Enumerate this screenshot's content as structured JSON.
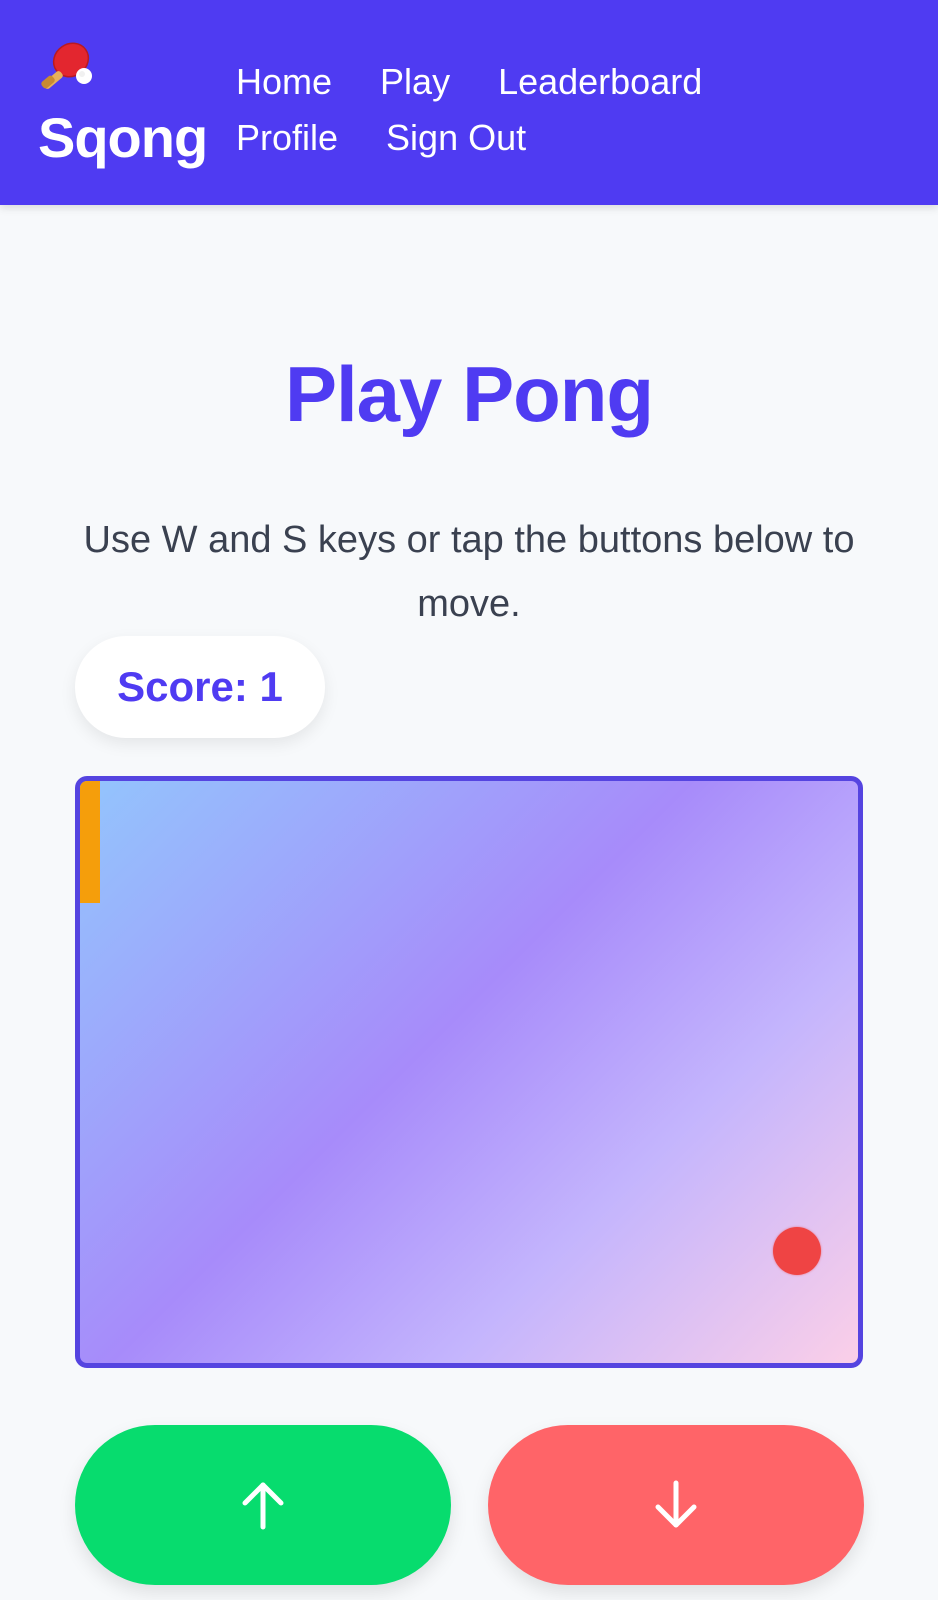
{
  "header": {
    "brand_icon": "ping-pong-paddle-icon",
    "brand_name": "Sqong",
    "nav": {
      "row1": [
        "Home",
        "Play",
        "Leaderboard"
      ],
      "row2": [
        "Profile",
        "Sign Out"
      ]
    }
  },
  "main": {
    "title": "Play Pong",
    "instructions": "Use W and S keys or tap the buttons below to move.",
    "score_label": "Score: 1"
  },
  "game": {
    "paddle_color": "#f59e0b",
    "ball_color": "#ef4444"
  },
  "controls": {
    "up_icon": "arrow-up-icon",
    "up_color": "#07dc6e",
    "down_icon": "arrow-down-icon",
    "down_color": "#ff6468"
  },
  "colors": {
    "accent": "#4f3bf2",
    "background": "#f7f9fb"
  }
}
